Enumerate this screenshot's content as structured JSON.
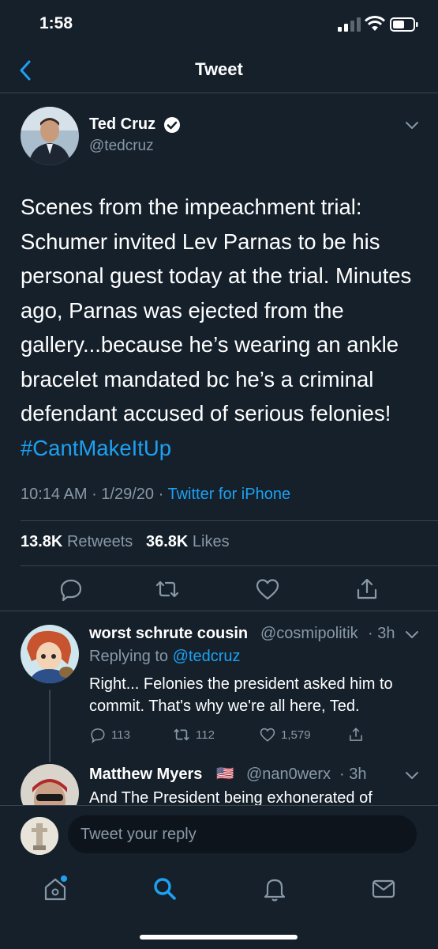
{
  "status_bar": {
    "time": "1:58"
  },
  "nav": {
    "title": "Tweet"
  },
  "tweet": {
    "author_name": "Ted Cruz",
    "author_handle": "@tedcruz",
    "text": "Scenes from the impeachment trial: Schumer invited Lev Parnas to be his personal guest today at the trial. Minutes ago, Parnas was ejected from the gallery...because he’s wearing an ankle bracelet mandated bc he’s a criminal defendant accused of serious felonies!",
    "hashtag": "#CantMakeItUp",
    "time": "10:14 AM",
    "date": "1/29/20",
    "source": "Twitter for iPhone",
    "retweets_count": "13.8K",
    "retweets_label": "Retweets",
    "likes_count": "36.8K",
    "likes_label": "Likes"
  },
  "replies": [
    {
      "name": "worst schrute cousin",
      "handle": "@cosmipolitik",
      "age": "3h",
      "replying_label": "Replying to",
      "replying_to": "@tedcruz",
      "text": "Right... Felonies the president asked him to commit. That's why we're all here, Ted.",
      "reply_count": "113",
      "retweet_count": "112",
      "like_count": "1,579"
    },
    {
      "name": "Matthew Myers",
      "flag": "🇺🇸",
      "handle": "@nan0werx",
      "age": "3h",
      "text": "And The President being exhonerated of"
    }
  ],
  "compose": {
    "placeholder": "Tweet your reply"
  },
  "colors": {
    "background": "#15202b",
    "accent": "#1da1f2",
    "secondary_text": "#8899a6",
    "divider": "#38444d"
  },
  "icons": {
    "back": "chevron-left-icon",
    "verified": "verified-badge-icon",
    "more": "chevron-down-icon",
    "reply": "reply-bubble-icon",
    "retweet": "retweet-icon",
    "like": "heart-icon",
    "share": "share-icon",
    "home": "home-icon",
    "search": "search-icon",
    "notifications": "bell-icon",
    "messages": "envelope-icon"
  }
}
